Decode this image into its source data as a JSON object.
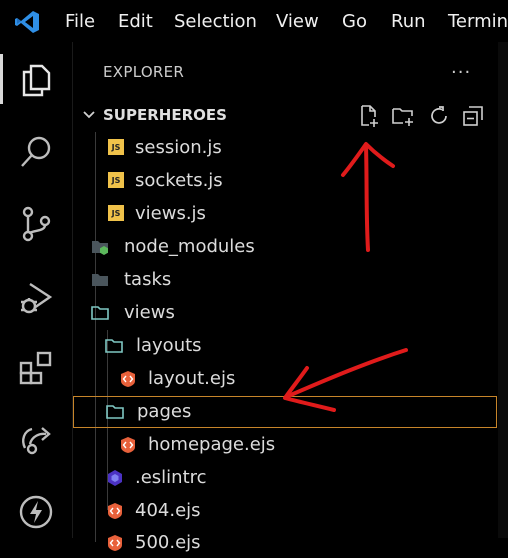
{
  "menubar": {
    "items": [
      "File",
      "Edit",
      "Selection",
      "View",
      "Go",
      "Run",
      "Termina"
    ]
  },
  "activitybar": {
    "icons": [
      "explorer-icon",
      "search-icon",
      "source-control-icon",
      "run-debug-icon",
      "extensions-icon",
      "live-share-icon",
      "thunder-icon"
    ]
  },
  "sidebar": {
    "title": "EXPLORER",
    "more": "···",
    "section": {
      "title": "SUPERHEROES",
      "toolbar": [
        "new-file-icon",
        "new-folder-icon",
        "refresh-icon",
        "collapse-all-icon"
      ]
    },
    "tree": [
      {
        "label": "session.js",
        "type": "js",
        "badge": "JS"
      },
      {
        "label": "sockets.js",
        "type": "js",
        "badge": "JS"
      },
      {
        "label": "views.js",
        "type": "js",
        "badge": "JS"
      },
      {
        "label": "node_modules",
        "type": "folder-node"
      },
      {
        "label": "tasks",
        "type": "folder"
      },
      {
        "label": "views",
        "type": "folder-open"
      },
      {
        "label": "layouts",
        "type": "folder-open"
      },
      {
        "label": "layout.ejs",
        "type": "ejs"
      },
      {
        "label": "pages",
        "type": "folder-open",
        "selected": true
      },
      {
        "label": "homepage.ejs",
        "type": "ejs"
      },
      {
        "label": ".eslintrc",
        "type": "eslint"
      },
      {
        "label": "404.ejs",
        "type": "ejs"
      },
      {
        "label": "500.ejs",
        "type": "ejs"
      }
    ]
  },
  "colors": {
    "accent_blue": "#2f8fe6",
    "selection_border": "#c7852a",
    "annotation_red": "#e01b1b",
    "js_yellow": "#f0c24a",
    "ejs_orange": "#e8613b",
    "folder_teal": "#7fc7c3"
  }
}
